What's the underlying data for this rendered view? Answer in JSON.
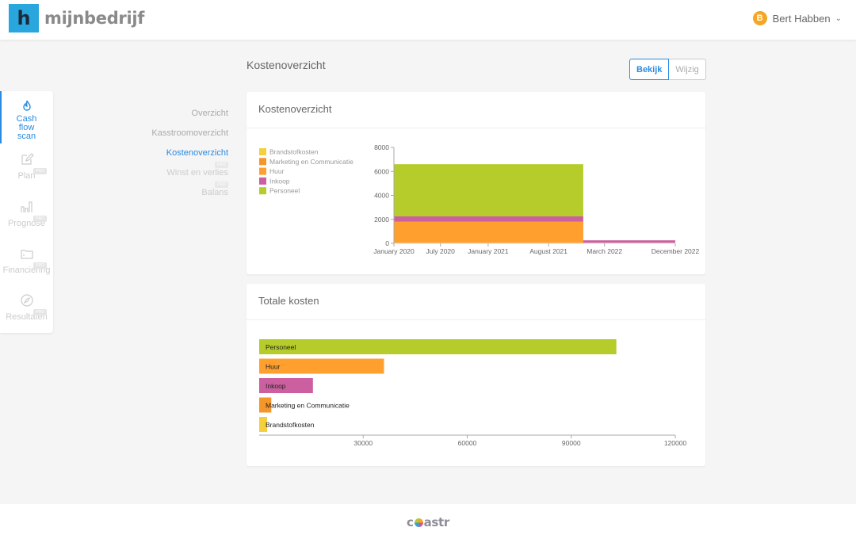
{
  "header": {
    "logo_mark": "h",
    "logo_text": "mijnbedrijf",
    "user_initial": "B",
    "user_name": "Bert Habben"
  },
  "sidebar": {
    "items": [
      {
        "label": "Cash flow scan",
        "icon": "flame-icon",
        "active": true,
        "pro": false
      },
      {
        "label": "Plan",
        "icon": "edit-icon",
        "active": false,
        "pro": true
      },
      {
        "label": "Prognose",
        "icon": "bar-chart-icon",
        "active": false,
        "pro": true
      },
      {
        "label": "Financiering",
        "icon": "wallet-icon",
        "active": false,
        "pro": true
      },
      {
        "label": "Resultaten",
        "icon": "compass-icon",
        "active": false,
        "pro": true
      }
    ],
    "pro_badge": "PRO"
  },
  "subnav": {
    "items": [
      {
        "label": "Overzicht",
        "state": "normal"
      },
      {
        "label": "Kasstroomoverzicht",
        "state": "normal"
      },
      {
        "label": "Kostenoverzicht",
        "state": "active"
      },
      {
        "label": "Winst en verlies",
        "state": "disabled"
      },
      {
        "label": "Balans",
        "state": "disabled"
      }
    ]
  },
  "page": {
    "title": "Kostenoverzicht",
    "view_button": "Bekijk",
    "edit_button": "Wijzig"
  },
  "colors": {
    "Brandstofkosten": "#f4d03f",
    "Marketing en Communicatie": "#f5962a",
    "Huur": "#ffa02e",
    "Inkoop": "#cc5fa0",
    "Personeel": "#b5cc2a",
    "accent": "#2a8be0"
  },
  "chart_data": [
    {
      "type": "area",
      "title": "Kostenoverzicht",
      "stacked": true,
      "legend": [
        "Brandstofkosten",
        "Marketing en Communicatie",
        "Huur",
        "Inkoop",
        "Personeel"
      ],
      "legend_position": "top-left",
      "x_ticks": [
        "January 2020",
        "July 2020",
        "January 2021",
        "August 2021",
        "March 2022",
        "December 2022"
      ],
      "x_tick_positions": [
        0,
        0.1653,
        0.3349,
        0.5497,
        0.7484,
        1.0
      ],
      "ylim": [
        0,
        8000
      ],
      "y_ticks": [
        0,
        2000,
        4000,
        6000,
        8000
      ],
      "segments": [
        {
          "from": "January 2020",
          "to": "November 2021",
          "from_frac": 0,
          "to_frac": 0.673,
          "values": {
            "Brandstofkosten": 0,
            "Marketing en Communicatie": 0,
            "Huur": 1800,
            "Inkoop": 450,
            "Personeel": 4350
          }
        },
        {
          "from": "November 2021",
          "to": "December 2022",
          "from_frac": 0.673,
          "to_frac": 1.0,
          "values": {
            "Brandstofkosten": 0,
            "Marketing en Communicatie": 0,
            "Huur": 50,
            "Inkoop": 200,
            "Personeel": 0
          }
        }
      ]
    },
    {
      "type": "bar",
      "orientation": "horizontal",
      "title": "Totale kosten",
      "categories": [
        "Personeel",
        "Huur",
        "Inkoop",
        "Marketing en Communicatie",
        "Brandstofkosten"
      ],
      "values": [
        103000,
        36000,
        15500,
        3500,
        2300
      ],
      "xlim": [
        0,
        120000
      ],
      "x_ticks": [
        30000,
        60000,
        90000,
        120000
      ]
    }
  ],
  "footer": {
    "brand_pre": "c",
    "brand_post": "astr"
  }
}
